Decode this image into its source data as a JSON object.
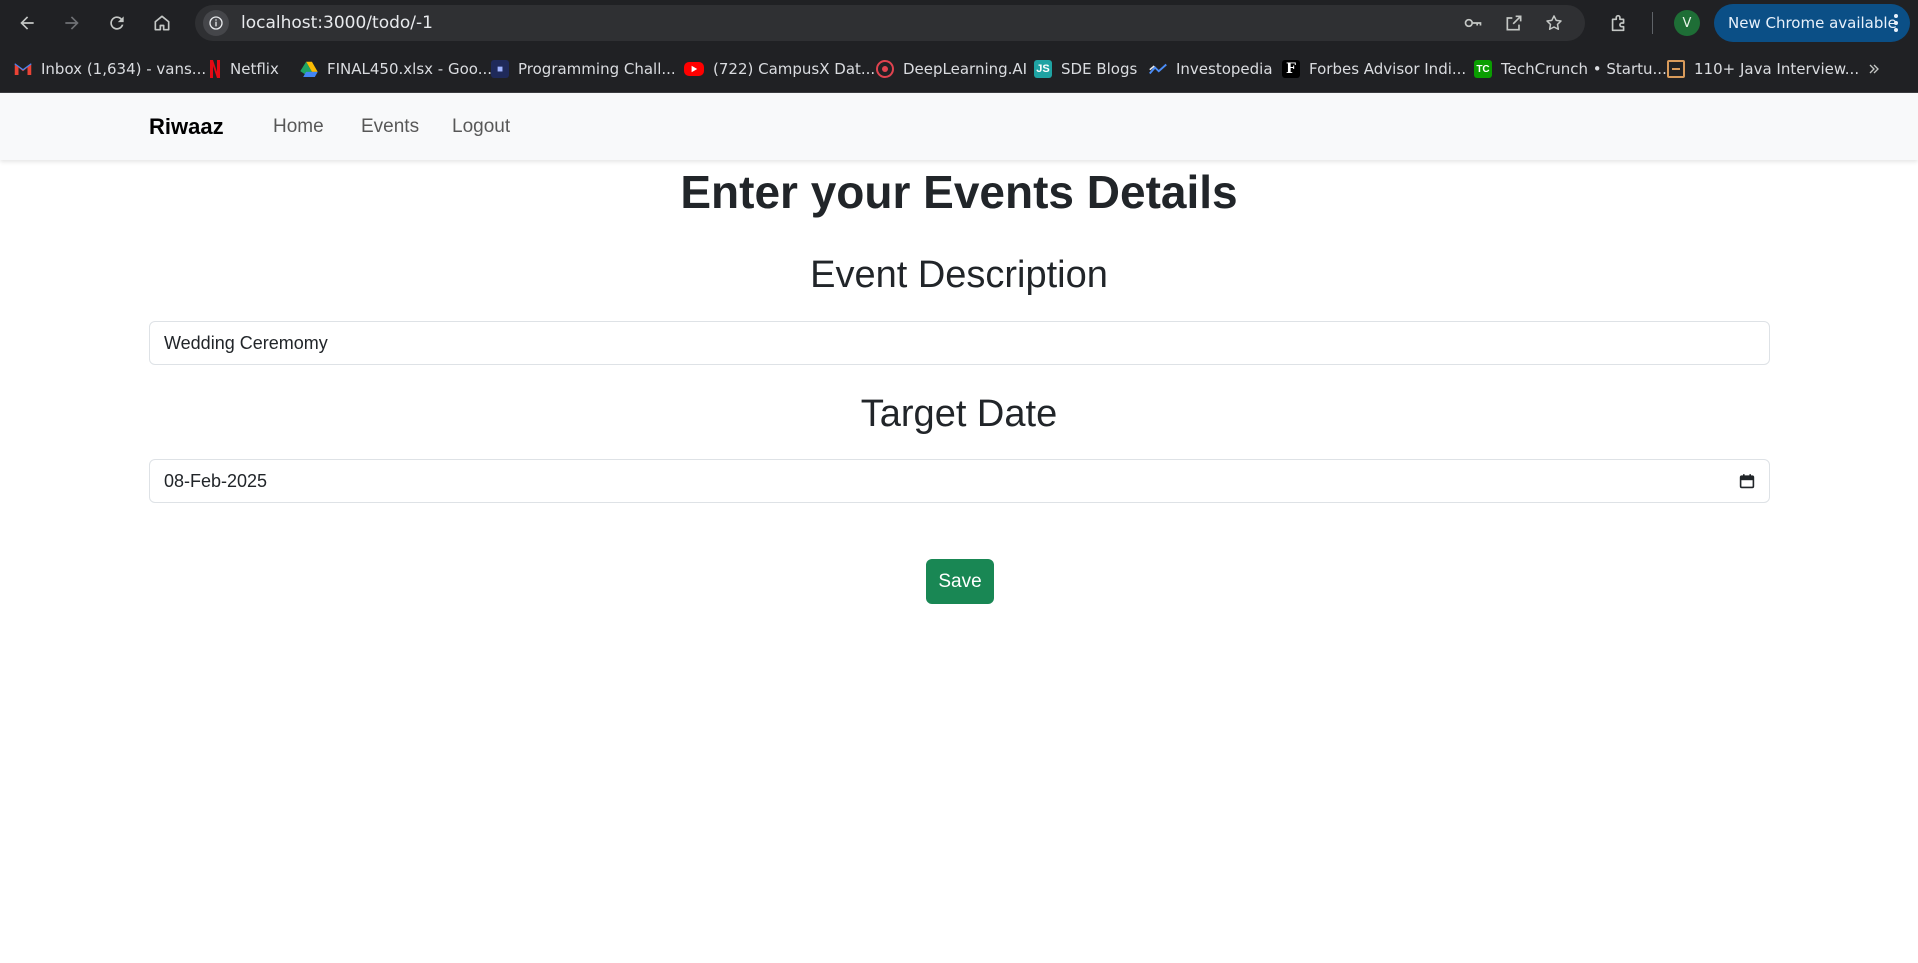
{
  "browser": {
    "url": "localhost:3000/todo/-1",
    "update_chip_label": "New Chrome available",
    "profile_initial": "V",
    "icons": [
      "back-icon",
      "forward-icon",
      "reload-icon",
      "home-icon",
      "site-info-icon",
      "password-key-icon",
      "open-in-app-icon",
      "bookmark-star-icon",
      "extensions-icon",
      "menu-dots-icon"
    ]
  },
  "bookmarks": [
    {
      "label": "Inbox (1,634) - vans...",
      "icon": "gmail-icon",
      "color": "#ea4335"
    },
    {
      "label": "Netflix",
      "icon": "netflix-icon",
      "color": "#e50914"
    },
    {
      "label": "FINAL450.xlsx - Goo...",
      "icon": "google-drive-icon",
      "color": "#fbbc04"
    },
    {
      "label": "Programming Chall...",
      "icon": "programming-icon",
      "color": "#1f2a5a"
    },
    {
      "label": "(722) CampusX Dat...",
      "icon": "youtube-icon",
      "color": "#ff0000"
    },
    {
      "label": "DeepLearning.AI",
      "icon": "deeplearning-icon",
      "color": "#e0434f"
    },
    {
      "label": "SDE Blogs",
      "icon": "sde-blogs-icon",
      "color": "#1fa3a3"
    },
    {
      "label": "Investopedia",
      "icon": "investopedia-icon",
      "color": "#2c6bd6"
    },
    {
      "label": "Forbes Advisor Indi...",
      "icon": "forbes-icon",
      "color": "#ffffff"
    },
    {
      "label": "TechCrunch • Startu...",
      "icon": "techcrunch-icon",
      "color": "#0a9e01"
    },
    {
      "label": "110+ Java Interview...",
      "icon": "java-interview-icon",
      "color": "#d99b5b"
    }
  ],
  "navbar": {
    "brand": "Riwaaz",
    "links": [
      "Home",
      "Events",
      "Logout"
    ]
  },
  "form": {
    "title": "Enter your Events Details",
    "description_label": "Event Description",
    "description_value": "Wedding Ceremomy",
    "date_label": "Target Date",
    "date_value": "08-Feb-2025",
    "save_label": "Save"
  },
  "colors": {
    "primary_button": "#198754",
    "navbar_bg": "#f8f9fa",
    "chrome_bg": "#202124"
  }
}
